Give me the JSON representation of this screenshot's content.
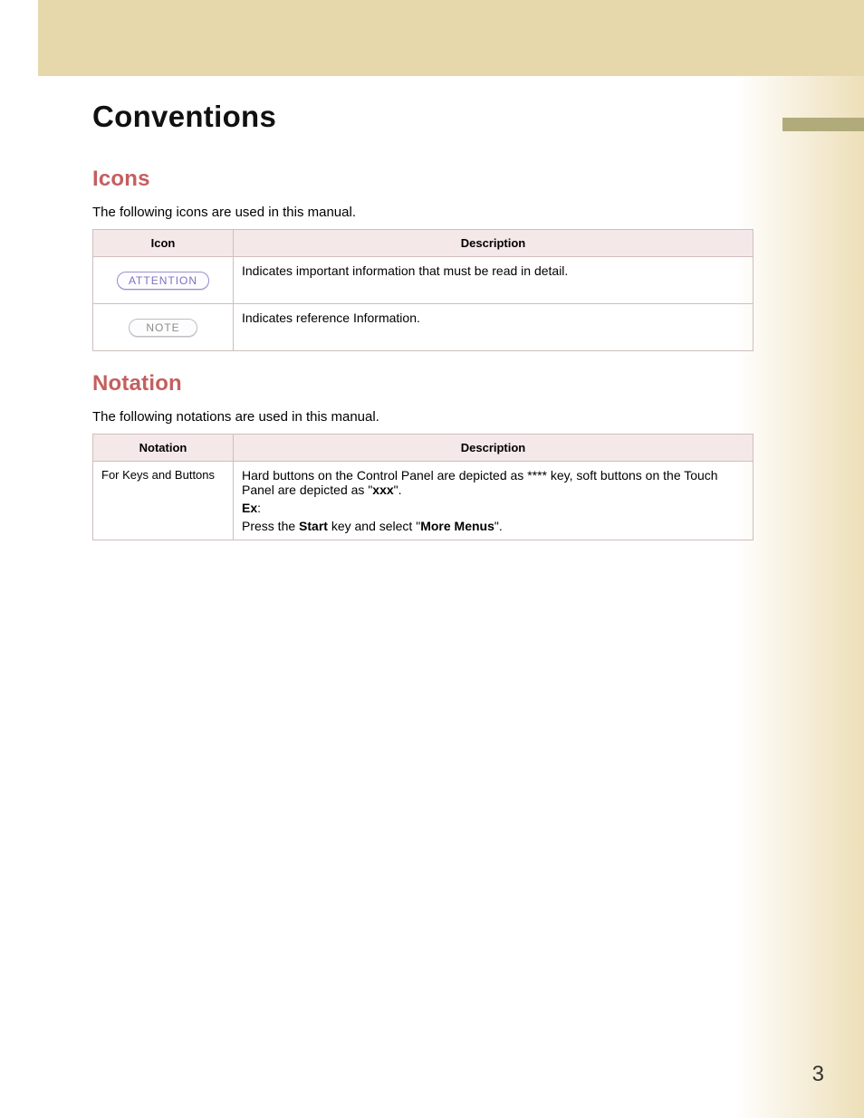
{
  "page": {
    "title": "Conventions",
    "number": "3"
  },
  "sections": {
    "icons": {
      "heading": "Icons",
      "intro": "The following icons are used in this manual.",
      "table": {
        "headers": {
          "col1": "Icon",
          "col2": "Description"
        },
        "rows": [
          {
            "icon_label": "ATTENTION",
            "desc": "Indicates important information that must be read in detail."
          },
          {
            "icon_label": "NOTE",
            "desc": "Indicates reference Information."
          }
        ]
      }
    },
    "notation": {
      "heading": "Notation",
      "intro": "The following notations are used in this manual.",
      "table": {
        "headers": {
          "col1": "Notation",
          "col2": "Description"
        },
        "rows": [
          {
            "label": "For Keys and Buttons",
            "desc_line1_a": "Hard buttons on the Control Panel are depicted as **** key, soft buttons on the Touch Panel are depicted as \"",
            "desc_line1_bold": "xxx",
            "desc_line1_b": "\".",
            "ex_label": "Ex",
            "ex_colon": ":",
            "ex_line_a": "Press the ",
            "ex_bold1": "Start",
            "ex_line_b": " key and select \"",
            "ex_bold2": "More Menus",
            "ex_line_c": "\"."
          }
        ]
      }
    }
  }
}
